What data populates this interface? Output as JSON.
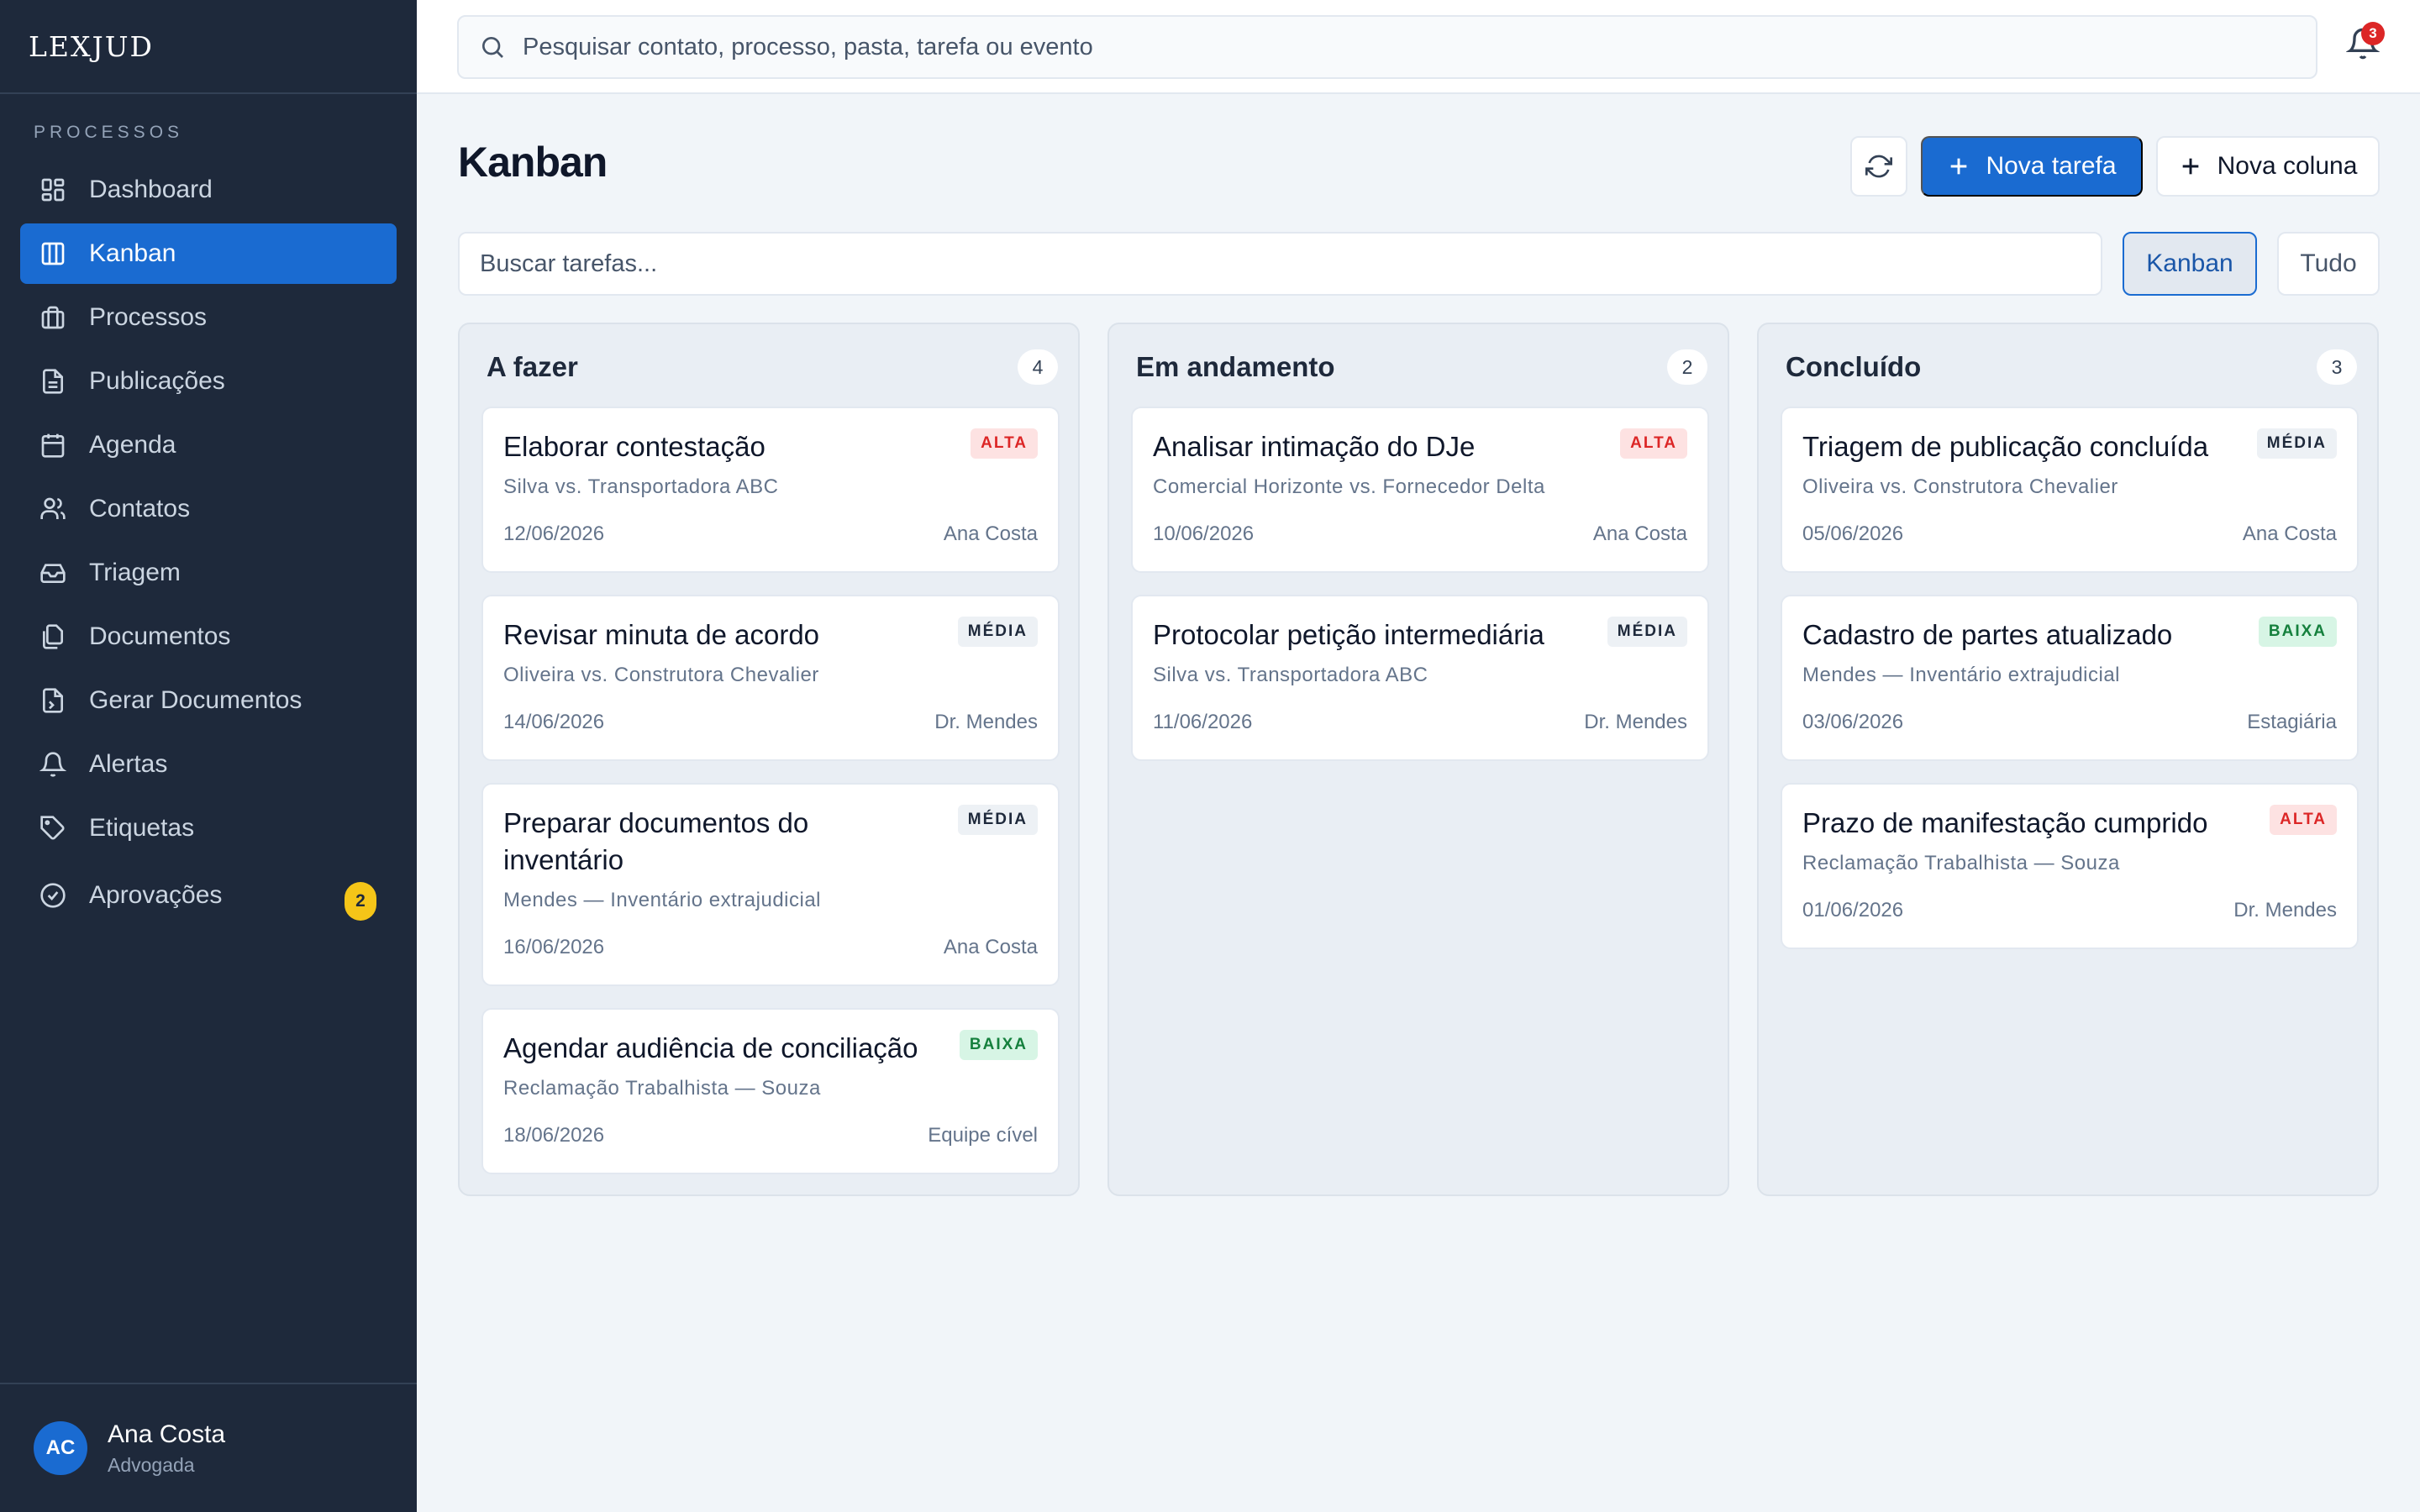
{
  "app": {
    "logo": "LEXJUD"
  },
  "sidebar": {
    "section_label": "PROCESSOS",
    "items": [
      {
        "label": "Dashboard",
        "icon": "dashboard-icon"
      },
      {
        "label": "Kanban",
        "icon": "kanban-icon",
        "active": true
      },
      {
        "label": "Processos",
        "icon": "briefcase-icon"
      },
      {
        "label": "Publicações",
        "icon": "file-text-icon"
      },
      {
        "label": "Agenda",
        "icon": "calendar-icon"
      },
      {
        "label": "Contatos",
        "icon": "users-icon"
      },
      {
        "label": "Triagem",
        "icon": "inbox-icon"
      },
      {
        "label": "Documentos",
        "icon": "files-icon"
      },
      {
        "label": "Gerar Documentos",
        "icon": "file-generate-icon"
      },
      {
        "label": "Alertas",
        "icon": "bell-icon"
      },
      {
        "label": "Etiquetas",
        "icon": "tag-icon"
      },
      {
        "label": "Aprovações",
        "icon": "check-circle-icon",
        "badge": "2"
      }
    ],
    "user": {
      "initials": "AC",
      "name": "Ana Costa",
      "role": "Advogada"
    }
  },
  "topbar": {
    "search_placeholder": "Pesquisar contato, processo, pasta, tarefa ou evento",
    "notifications_count": "3"
  },
  "main": {
    "title": "Kanban",
    "new_task_label": "Nova tarefa",
    "new_column_label": "Nova coluna",
    "task_search_placeholder": "Buscar tarefas...",
    "view_kanban_label": "Kanban",
    "view_all_label": "Tudo"
  },
  "board": {
    "columns": [
      {
        "title": "A fazer",
        "count": "4",
        "cards": [
          {
            "title": "Elaborar contestação",
            "priority": "ALTA",
            "case": "Silva vs. Transportadora ABC",
            "date": "12/06/2026",
            "owner": "Ana Costa"
          },
          {
            "title": "Revisar minuta de acordo",
            "priority": "MÉDIA",
            "case": "Oliveira vs. Construtora Chevalier",
            "date": "14/06/2026",
            "owner": "Dr. Mendes"
          },
          {
            "title": "Preparar documentos do inventário",
            "priority": "MÉDIA",
            "case": "Mendes — Inventário extrajudicial",
            "date": "16/06/2026",
            "owner": "Ana Costa"
          },
          {
            "title": "Agendar audiência de conciliação",
            "priority": "BAIXA",
            "case": "Reclamação Trabalhista — Souza",
            "date": "18/06/2026",
            "owner": "Equipe cível"
          }
        ]
      },
      {
        "title": "Em andamento",
        "count": "2",
        "cards": [
          {
            "title": "Analisar intimação do DJe",
            "priority": "ALTA",
            "case": "Comercial Horizonte vs. Fornecedor Delta",
            "date": "10/06/2026",
            "owner": "Ana Costa"
          },
          {
            "title": "Protocolar petição intermediária",
            "priority": "MÉDIA",
            "case": "Silva vs. Transportadora ABC",
            "date": "11/06/2026",
            "owner": "Dr. Mendes"
          }
        ]
      },
      {
        "title": "Concluído",
        "count": "3",
        "cards": [
          {
            "title": "Triagem de publicação concluída",
            "priority": "MÉDIA",
            "case": "Oliveira vs. Construtora Chevalier",
            "date": "05/06/2026",
            "owner": "Ana Costa"
          },
          {
            "title": "Cadastro de partes atualizado",
            "priority": "BAIXA",
            "case": "Mendes — Inventário extrajudicial",
            "date": "03/06/2026",
            "owner": "Estagiária"
          },
          {
            "title": "Prazo de manifestação cumprido",
            "priority": "ALTA",
            "case": "Reclamação Trabalhista — Souza",
            "date": "01/06/2026",
            "owner": "Dr. Mendes"
          }
        ]
      }
    ]
  },
  "colors": {
    "sidebar_bg": "#1e293b",
    "accent": "#1a6bd1",
    "priority_high": "#dc2626",
    "priority_medium": "#1e293b",
    "priority_low": "#15803d",
    "badge_yellow": "#f5c518"
  }
}
